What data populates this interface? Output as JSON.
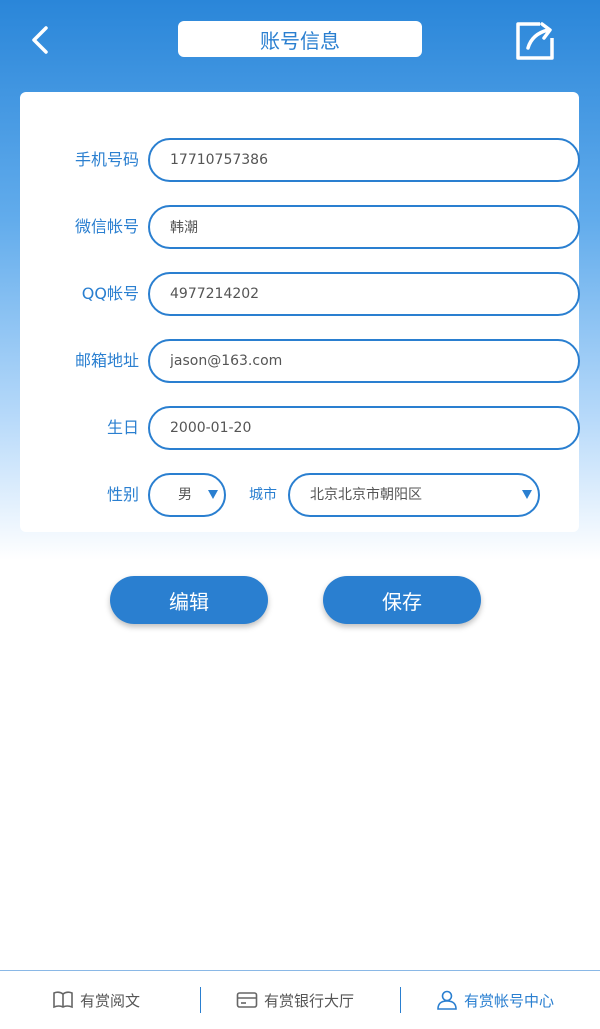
{
  "header": {
    "title": "账号信息"
  },
  "form": {
    "phone": {
      "label": "手机号码",
      "value": "17710757386"
    },
    "wechat": {
      "label": "微信帐号",
      "value": "韩潮"
    },
    "qq": {
      "label": "QQ帐号",
      "value": "4977214202"
    },
    "email": {
      "label": "邮箱地址",
      "value": "jason@163.com"
    },
    "birthday": {
      "label": "生日",
      "value": "2000-01-20"
    },
    "gender": {
      "label": "性别",
      "value": "男"
    },
    "city": {
      "label": "城市",
      "value": "北京北京市朝阳区"
    }
  },
  "actions": {
    "edit": "编辑",
    "save": "保存"
  },
  "nav": {
    "items": [
      {
        "label": "有赏阅文",
        "icon": "book-icon"
      },
      {
        "label": "有赏银行大厅",
        "icon": "card-icon"
      },
      {
        "label": "有赏帐号中心",
        "icon": "user-icon",
        "active": true
      }
    ]
  },
  "colors": {
    "accent": "#2a7fd0"
  }
}
